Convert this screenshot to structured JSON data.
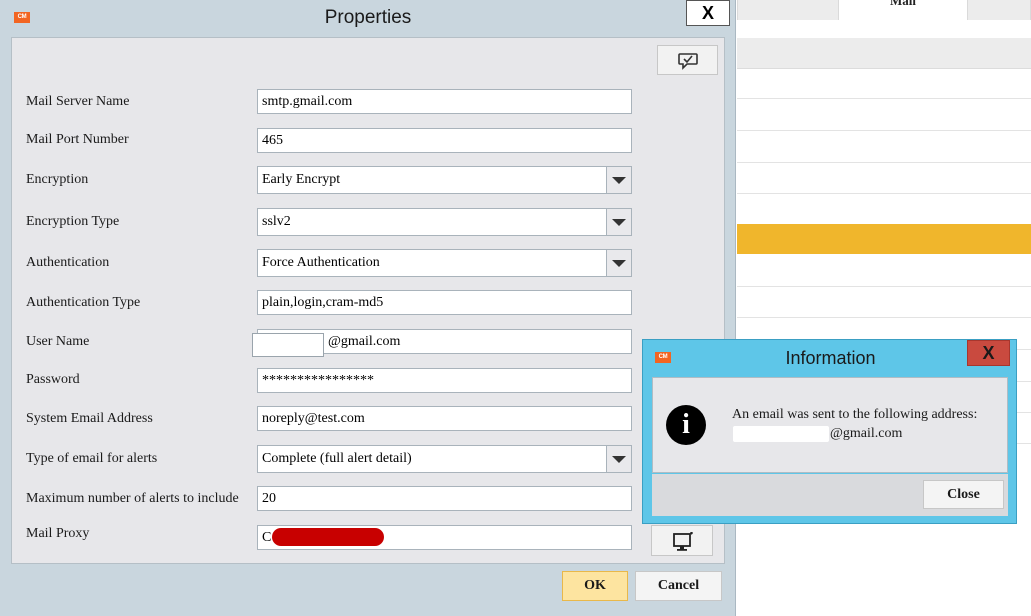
{
  "background_app": {
    "tab_label": "Mail",
    "highlight_color": "#f0b62c"
  },
  "properties": {
    "title": "Properties",
    "close_symbol": "X",
    "logo_text": "CM",
    "help_icon": "speech-bubble-check-icon",
    "fields": {
      "mail_server_name": {
        "label": "Mail Server Name",
        "value": "smtp.gmail.com"
      },
      "mail_port_number": {
        "label": "Mail Port Number",
        "value": "465"
      },
      "encryption": {
        "label": "Encryption",
        "value": "Early Encrypt"
      },
      "encryption_type": {
        "label": "Encryption Type",
        "value": "sslv2"
      },
      "authentication": {
        "label": "Authentication",
        "value": "Force Authentication"
      },
      "authentication_type": {
        "label": "Authentication Type",
        "value": "plain,login,cram-md5"
      },
      "user_name": {
        "label": "User Name",
        "value": "@gmail.com"
      },
      "password": {
        "label": "Password",
        "value": "****************"
      },
      "system_email_address": {
        "label": "System Email Address",
        "value": "noreply@test.com"
      },
      "alert_email_type": {
        "label": "Type of email for alerts",
        "value": "Complete (full alert detail)"
      },
      "max_alerts": {
        "label": "Maximum number of alerts to include",
        "value": "20"
      },
      "mail_proxy": {
        "label": "Mail Proxy",
        "value": "C"
      }
    },
    "proxy_button_icon": "monitor-icon",
    "ok_label": "OK",
    "cancel_label": "Cancel"
  },
  "information": {
    "title": "Information",
    "close_symbol": "X",
    "logo_text": "CM",
    "icon_glyph": "i",
    "message": "An email was sent to the following address:",
    "address": "@gmail.com",
    "close_label": "Close"
  },
  "colors": {
    "dialog_frame": "#c9d6de",
    "info_frame": "#5ec6e8",
    "info_close": "#c94a3f",
    "ok_button": "#fde4a0",
    "redaction": "#c80000"
  }
}
